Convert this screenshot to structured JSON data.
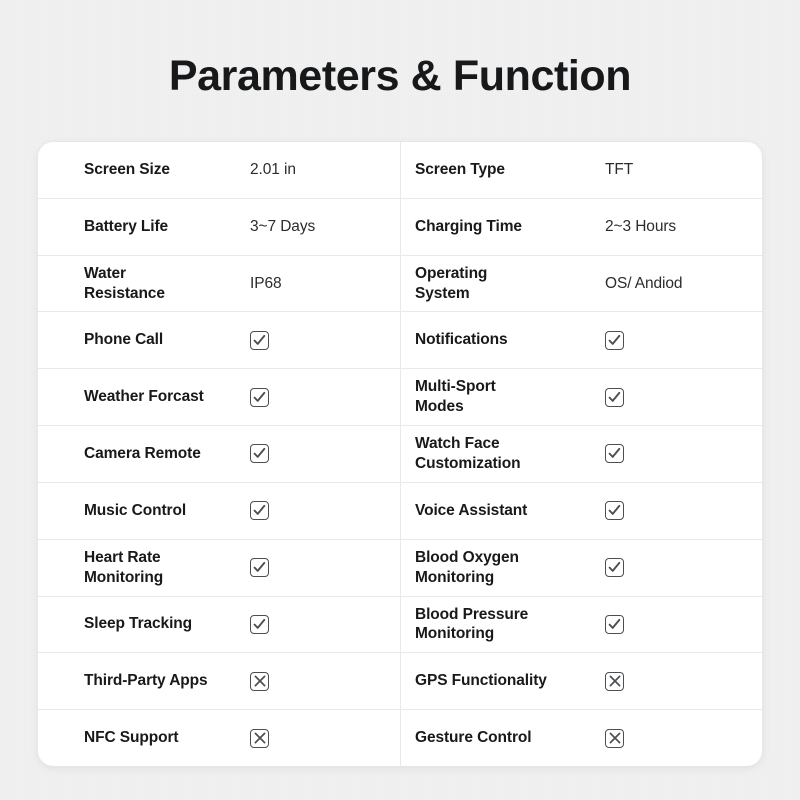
{
  "page": {
    "title": "Parameters & Function",
    "background_color": "#f1f1f1",
    "card_color": "#ffffff",
    "text_color": "#17191b",
    "divider_color": "#e9e9e9",
    "mark_color": "#4c4f52"
  },
  "table": {
    "columns": 2,
    "row_count": 11,
    "rows": [
      {
        "left": {
          "label": "Screen Size",
          "type": "text",
          "value": "2.01 in"
        },
        "right": {
          "label": "Screen Type",
          "type": "text",
          "value": "TFT"
        }
      },
      {
        "left": {
          "label": "Battery Life",
          "type": "text",
          "value": "3~7 Days"
        },
        "right": {
          "label": "Charging Time",
          "type": "text",
          "value": "2~3 Hours"
        }
      },
      {
        "left": {
          "label": "Water\nResistance",
          "type": "text",
          "value": "IP68"
        },
        "right": {
          "label": "Operating\nSystem",
          "type": "text",
          "value": "OS/ Andiod"
        }
      },
      {
        "left": {
          "label": "Phone Call",
          "type": "check",
          "value": "check-icon"
        },
        "right": {
          "label": "Notifications",
          "type": "check",
          "value": "check-icon"
        }
      },
      {
        "left": {
          "label": "Weather Forcast",
          "type": "check",
          "value": "check-icon"
        },
        "right": {
          "label": "Multi-Sport\nModes",
          "type": "check",
          "value": "check-icon"
        }
      },
      {
        "left": {
          "label": "Camera Remote",
          "type": "check",
          "value": "check-icon"
        },
        "right": {
          "label": "Watch Face\nCustomization",
          "type": "check",
          "value": "check-icon"
        }
      },
      {
        "left": {
          "label": "Music Control",
          "type": "check",
          "value": "check-icon"
        },
        "right": {
          "label": "Voice Assistant",
          "type": "check",
          "value": "check-icon"
        }
      },
      {
        "left": {
          "label": "Heart Rate\nMonitoring",
          "type": "check",
          "value": "check-icon"
        },
        "right": {
          "label": "Blood Oxygen\nMonitoring",
          "type": "check",
          "value": "check-icon"
        }
      },
      {
        "left": {
          "label": "Sleep Tracking",
          "type": "check",
          "value": "check-icon"
        },
        "right": {
          "label": "Blood Pressure\nMonitoring",
          "type": "check",
          "value": "check-icon"
        }
      },
      {
        "left": {
          "label": "Third-Party Apps",
          "type": "cross",
          "value": "cross-icon"
        },
        "right": {
          "label": "GPS Functionality",
          "type": "cross",
          "value": "cross-icon"
        }
      },
      {
        "left": {
          "label": "NFC Support",
          "type": "cross",
          "value": "cross-icon"
        },
        "right": {
          "label": "Gesture Control",
          "type": "cross",
          "value": "cross-icon"
        }
      }
    ]
  }
}
